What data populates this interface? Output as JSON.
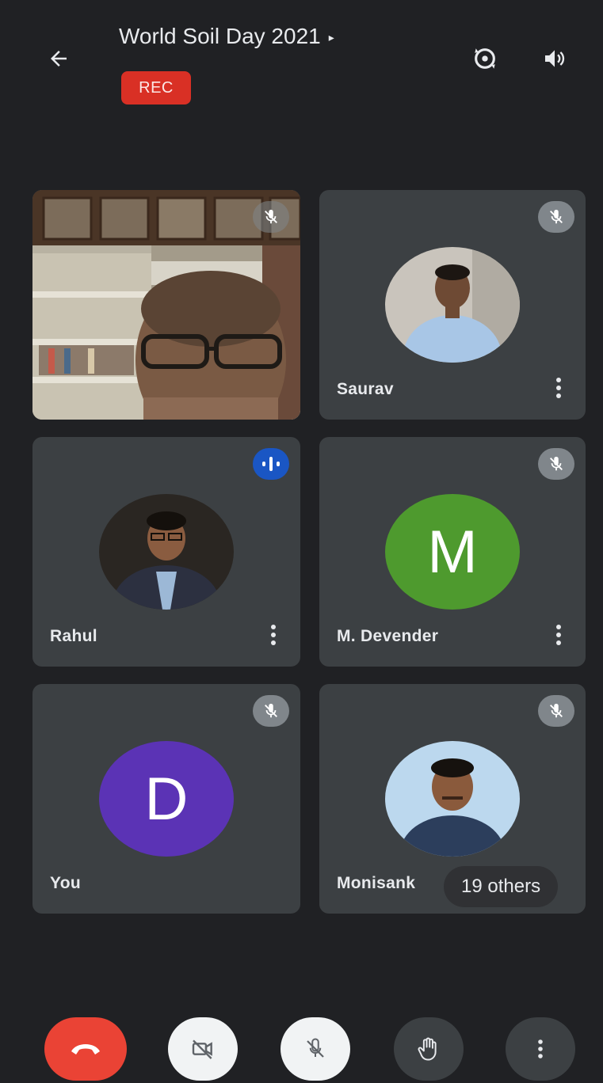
{
  "header": {
    "title": "World Soil Day 2021",
    "rec_label": "REC"
  },
  "icons": {
    "back": "arrow-left-icon",
    "switch_camera": "camera-switch-icon",
    "audio": "speaker-icon",
    "muted": "mic-off-icon",
    "speaking": "audio-wave-icon",
    "more": "more-vertical-icon",
    "end_call": "phone-hangup-icon",
    "camera_off": "camera-off-icon",
    "mic_off": "mic-off-icon",
    "raise_hand": "hand-icon"
  },
  "participants": [
    {
      "name": "",
      "type": "video",
      "muted": true
    },
    {
      "name": "Saurav",
      "type": "photo",
      "muted": true
    },
    {
      "name": "Rahul",
      "type": "photo",
      "speaking": true
    },
    {
      "name": "M. Devender",
      "type": "initial",
      "initial": "M",
      "color": "#4e9a2e",
      "muted": true
    },
    {
      "name": "You",
      "type": "initial",
      "initial": "D",
      "color": "#5b33b5",
      "muted": true
    },
    {
      "name": "Monisank",
      "type": "photo",
      "muted": true
    }
  ],
  "others_chip": "19 others",
  "colors": {
    "background": "#202124",
    "tile": "#3c4043",
    "rec": "#d93025",
    "end_call": "#ea4335",
    "speaking": "#1a56c4"
  }
}
